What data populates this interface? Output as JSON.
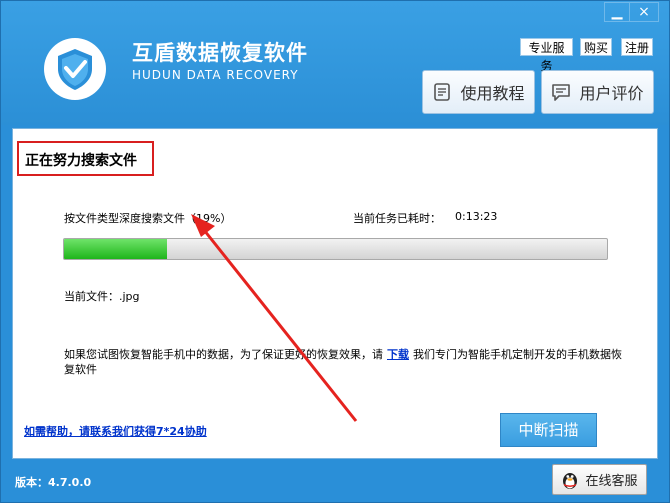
{
  "window": {
    "minimize_glyph": "▁",
    "close_glyph": "×"
  },
  "header": {
    "title": "互盾数据恢复软件",
    "subtitle": "HUDUN DATA RECOVERY",
    "logo_icon": "shield-check-icon",
    "links": {
      "pro": "专业服务",
      "buy": "购买",
      "register": "注册"
    },
    "tutorial_label": "使用教程",
    "review_label": "用户评价"
  },
  "scan": {
    "status": "正在努力搜索文件",
    "mode_label": "按文件类型深度搜索文件（19%）",
    "progress_percent": 19,
    "elapsed_label": "当前任务已耗时：",
    "elapsed_value": "0:13:23",
    "current_file": "当前文件：.jpg"
  },
  "info": {
    "text_before": "如果您试图恢复智能手机中的数据，为了保证更好的恢复效果，请",
    "download_link": "下载",
    "text_after": "我们专门为智能手机定制开发的手机数据恢复软件"
  },
  "help_link": "如需帮助，请联系我们获得7*24协助",
  "stop_button": "中断扫描",
  "footer": {
    "version": "版本：4.7.0.0",
    "service_label": "在线客服"
  },
  "colors": {
    "accent": "#2a8fd8",
    "progress": "#1fb51b",
    "highlight": "#d81f1f",
    "link": "#0033cc"
  }
}
